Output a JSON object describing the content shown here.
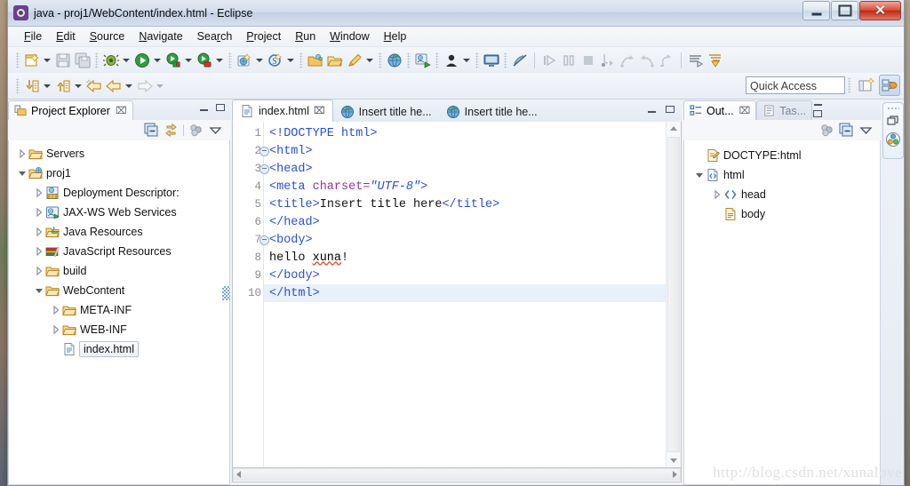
{
  "window": {
    "title": "java - proj1/WebContent/index.html - Eclipse",
    "app_icon": "eclipse-icon",
    "controls": {
      "minimize": "–",
      "maximize": "□",
      "close": "✕"
    }
  },
  "menubar": {
    "items": [
      {
        "label": "File",
        "mnemonic": "F"
      },
      {
        "label": "Edit",
        "mnemonic": "E"
      },
      {
        "label": "Source",
        "mnemonic": "S"
      },
      {
        "label": "Navigate",
        "mnemonic": "N"
      },
      {
        "label": "Search",
        "mnemonic": "r"
      },
      {
        "label": "Project",
        "mnemonic": "P"
      },
      {
        "label": "Run",
        "mnemonic": "R"
      },
      {
        "label": "Window",
        "mnemonic": "W"
      },
      {
        "label": "Help",
        "mnemonic": "H"
      }
    ]
  },
  "toolbar": {
    "row1_icons": [
      "new-wizard-icon",
      "save-icon",
      "save-all-icon",
      "debug-icon",
      "run-icon",
      "run-server-icon",
      "run-stop-icon",
      "new-web-project-icon",
      "search-icon",
      "open-type-icon",
      "open-folder-icon",
      "marker-icon",
      "globe-icon",
      "external-tools-icon",
      "profile-icon",
      "display-icon",
      "skip-breakpoints-icon",
      "resume-icon",
      "suspend-icon",
      "terminate-icon",
      "step-into-icon",
      "step-over-icon",
      "step-return-icon",
      "drop-to-frame-icon",
      "next-annotation-icon",
      "previous-annotation-icon"
    ],
    "row2_icons": [
      "last-edit-location-icon",
      "previous-edit-icon",
      "back-icon",
      "forward-icon",
      "history-icon"
    ],
    "quick_access": {
      "placeholder": "Quick Access",
      "value": ""
    },
    "perspective_buttons": [
      "open-perspective-icon",
      "java-ee-perspective-icon"
    ]
  },
  "explorer": {
    "tab": {
      "label": "Project Explorer",
      "icon": "project-explorer-icon",
      "close": "⌧"
    },
    "toolbar_icons": [
      "collapse-all-icon",
      "link-with-editor-icon",
      "view-filter-icon",
      "view-menu-icon"
    ],
    "tree": [
      {
        "label": "Servers",
        "icon": "folder-icon",
        "indent": 0,
        "state": "collapsed",
        "selected": false
      },
      {
        "label": "proj1",
        "icon": "web-project-icon",
        "indent": 0,
        "state": "expanded",
        "selected": false
      },
      {
        "label": "Deployment Descriptor:",
        "icon": "deployment-descriptor-icon",
        "indent": 1,
        "state": "collapsed",
        "selected": false
      },
      {
        "label": "JAX-WS Web Services",
        "icon": "jaxws-icon",
        "indent": 1,
        "state": "collapsed",
        "selected": false
      },
      {
        "label": "Java Resources",
        "icon": "java-resources-icon",
        "indent": 1,
        "state": "collapsed",
        "selected": false
      },
      {
        "label": "JavaScript Resources",
        "icon": "javascript-resources-icon",
        "indent": 1,
        "state": "collapsed",
        "selected": false
      },
      {
        "label": "build",
        "icon": "folder-icon",
        "indent": 1,
        "state": "collapsed",
        "selected": false
      },
      {
        "label": "WebContent",
        "icon": "folder-icon",
        "indent": 1,
        "state": "expanded",
        "selected": false
      },
      {
        "label": "META-INF",
        "icon": "folder-icon",
        "indent": 2,
        "state": "collapsed",
        "selected": false
      },
      {
        "label": "WEB-INF",
        "icon": "folder-icon",
        "indent": 2,
        "state": "collapsed",
        "selected": false
      },
      {
        "label": "index.html",
        "icon": "html-file-icon",
        "indent": 2,
        "state": "leaf",
        "selected": true
      }
    ]
  },
  "editor": {
    "tabs": [
      {
        "label": "index.html",
        "icon": "html-file-icon",
        "active": true,
        "close": "⌧"
      },
      {
        "label": "Insert title he...",
        "icon": "browser-icon",
        "active": false,
        "close": ""
      },
      {
        "label": "Insert title he...",
        "icon": "browser-icon",
        "active": false,
        "close": ""
      }
    ],
    "lines": [
      {
        "num": "1",
        "fold": false,
        "current": false,
        "tokens": [
          {
            "t": "tag",
            "s": "<!DOCTYPE html>"
          }
        ]
      },
      {
        "num": "2",
        "fold": true,
        "current": false,
        "tokens": [
          {
            "t": "tag",
            "s": "<html>"
          }
        ]
      },
      {
        "num": "3",
        "fold": true,
        "current": false,
        "tokens": [
          {
            "t": "tag",
            "s": "<head>"
          }
        ]
      },
      {
        "num": "4",
        "fold": false,
        "current": false,
        "tokens": [
          {
            "t": "tag",
            "s": "<meta "
          },
          {
            "t": "attr",
            "s": "charset="
          },
          {
            "t": "val",
            "s": "\"UTF-8\""
          },
          {
            "t": "tag",
            "s": ">"
          }
        ]
      },
      {
        "num": "5",
        "fold": false,
        "current": false,
        "tokens": [
          {
            "t": "tag",
            "s": "<title>"
          },
          {
            "t": "txt",
            "s": "Insert title here"
          },
          {
            "t": "tag",
            "s": "</title>"
          }
        ]
      },
      {
        "num": "6",
        "fold": false,
        "current": false,
        "tokens": [
          {
            "t": "tag",
            "s": "</head>"
          }
        ]
      },
      {
        "num": "7",
        "fold": true,
        "current": false,
        "tokens": [
          {
            "t": "tag",
            "s": "<body>"
          }
        ]
      },
      {
        "num": "8",
        "fold": false,
        "current": false,
        "tokens": [
          {
            "t": "txt",
            "s": "hello "
          },
          {
            "t": "misspell",
            "s": "xuna"
          },
          {
            "t": "txt",
            "s": "!"
          }
        ]
      },
      {
        "num": "9",
        "fold": false,
        "current": false,
        "tokens": [
          {
            "t": "tag",
            "s": "</body>"
          }
        ]
      },
      {
        "num": "10",
        "fold": false,
        "current": true,
        "tokens": [
          {
            "t": "tag",
            "s": "</html>"
          }
        ]
      }
    ],
    "colors": {
      "tag": "#2a4fd7",
      "attribute": "#9a2fa0",
      "value": "#2a4fd7",
      "text": "#111111",
      "current_line": "#e8f1fb",
      "misspell_underline": "#d9542b"
    }
  },
  "outline": {
    "tabs": [
      {
        "label": "Out...",
        "icon": "outline-icon",
        "active": true,
        "close": "⌧"
      },
      {
        "label": "Tas...",
        "icon": "tasks-icon",
        "active": false,
        "close": ""
      }
    ],
    "toolbar_icons": [
      "view-filter-icon",
      "collapse-all-icon",
      "view-menu-icon"
    ],
    "tree": [
      {
        "label": "DOCTYPE:html",
        "icon": "doctype-icon",
        "indent": 0,
        "state": "leaf"
      },
      {
        "label": "html",
        "icon": "html-tag-icon",
        "indent": 0,
        "state": "expanded"
      },
      {
        "label": "head",
        "icon": "element-icon",
        "indent": 1,
        "state": "collapsed"
      },
      {
        "label": "body",
        "icon": "body-tag-icon",
        "indent": 1,
        "state": "leaf"
      }
    ]
  },
  "fastview": {
    "buttons": [
      "restore-icon",
      "java-ee-perspective-icon"
    ]
  },
  "watermark": {
    "text": "http://blog.csdn.net/xunalove"
  }
}
